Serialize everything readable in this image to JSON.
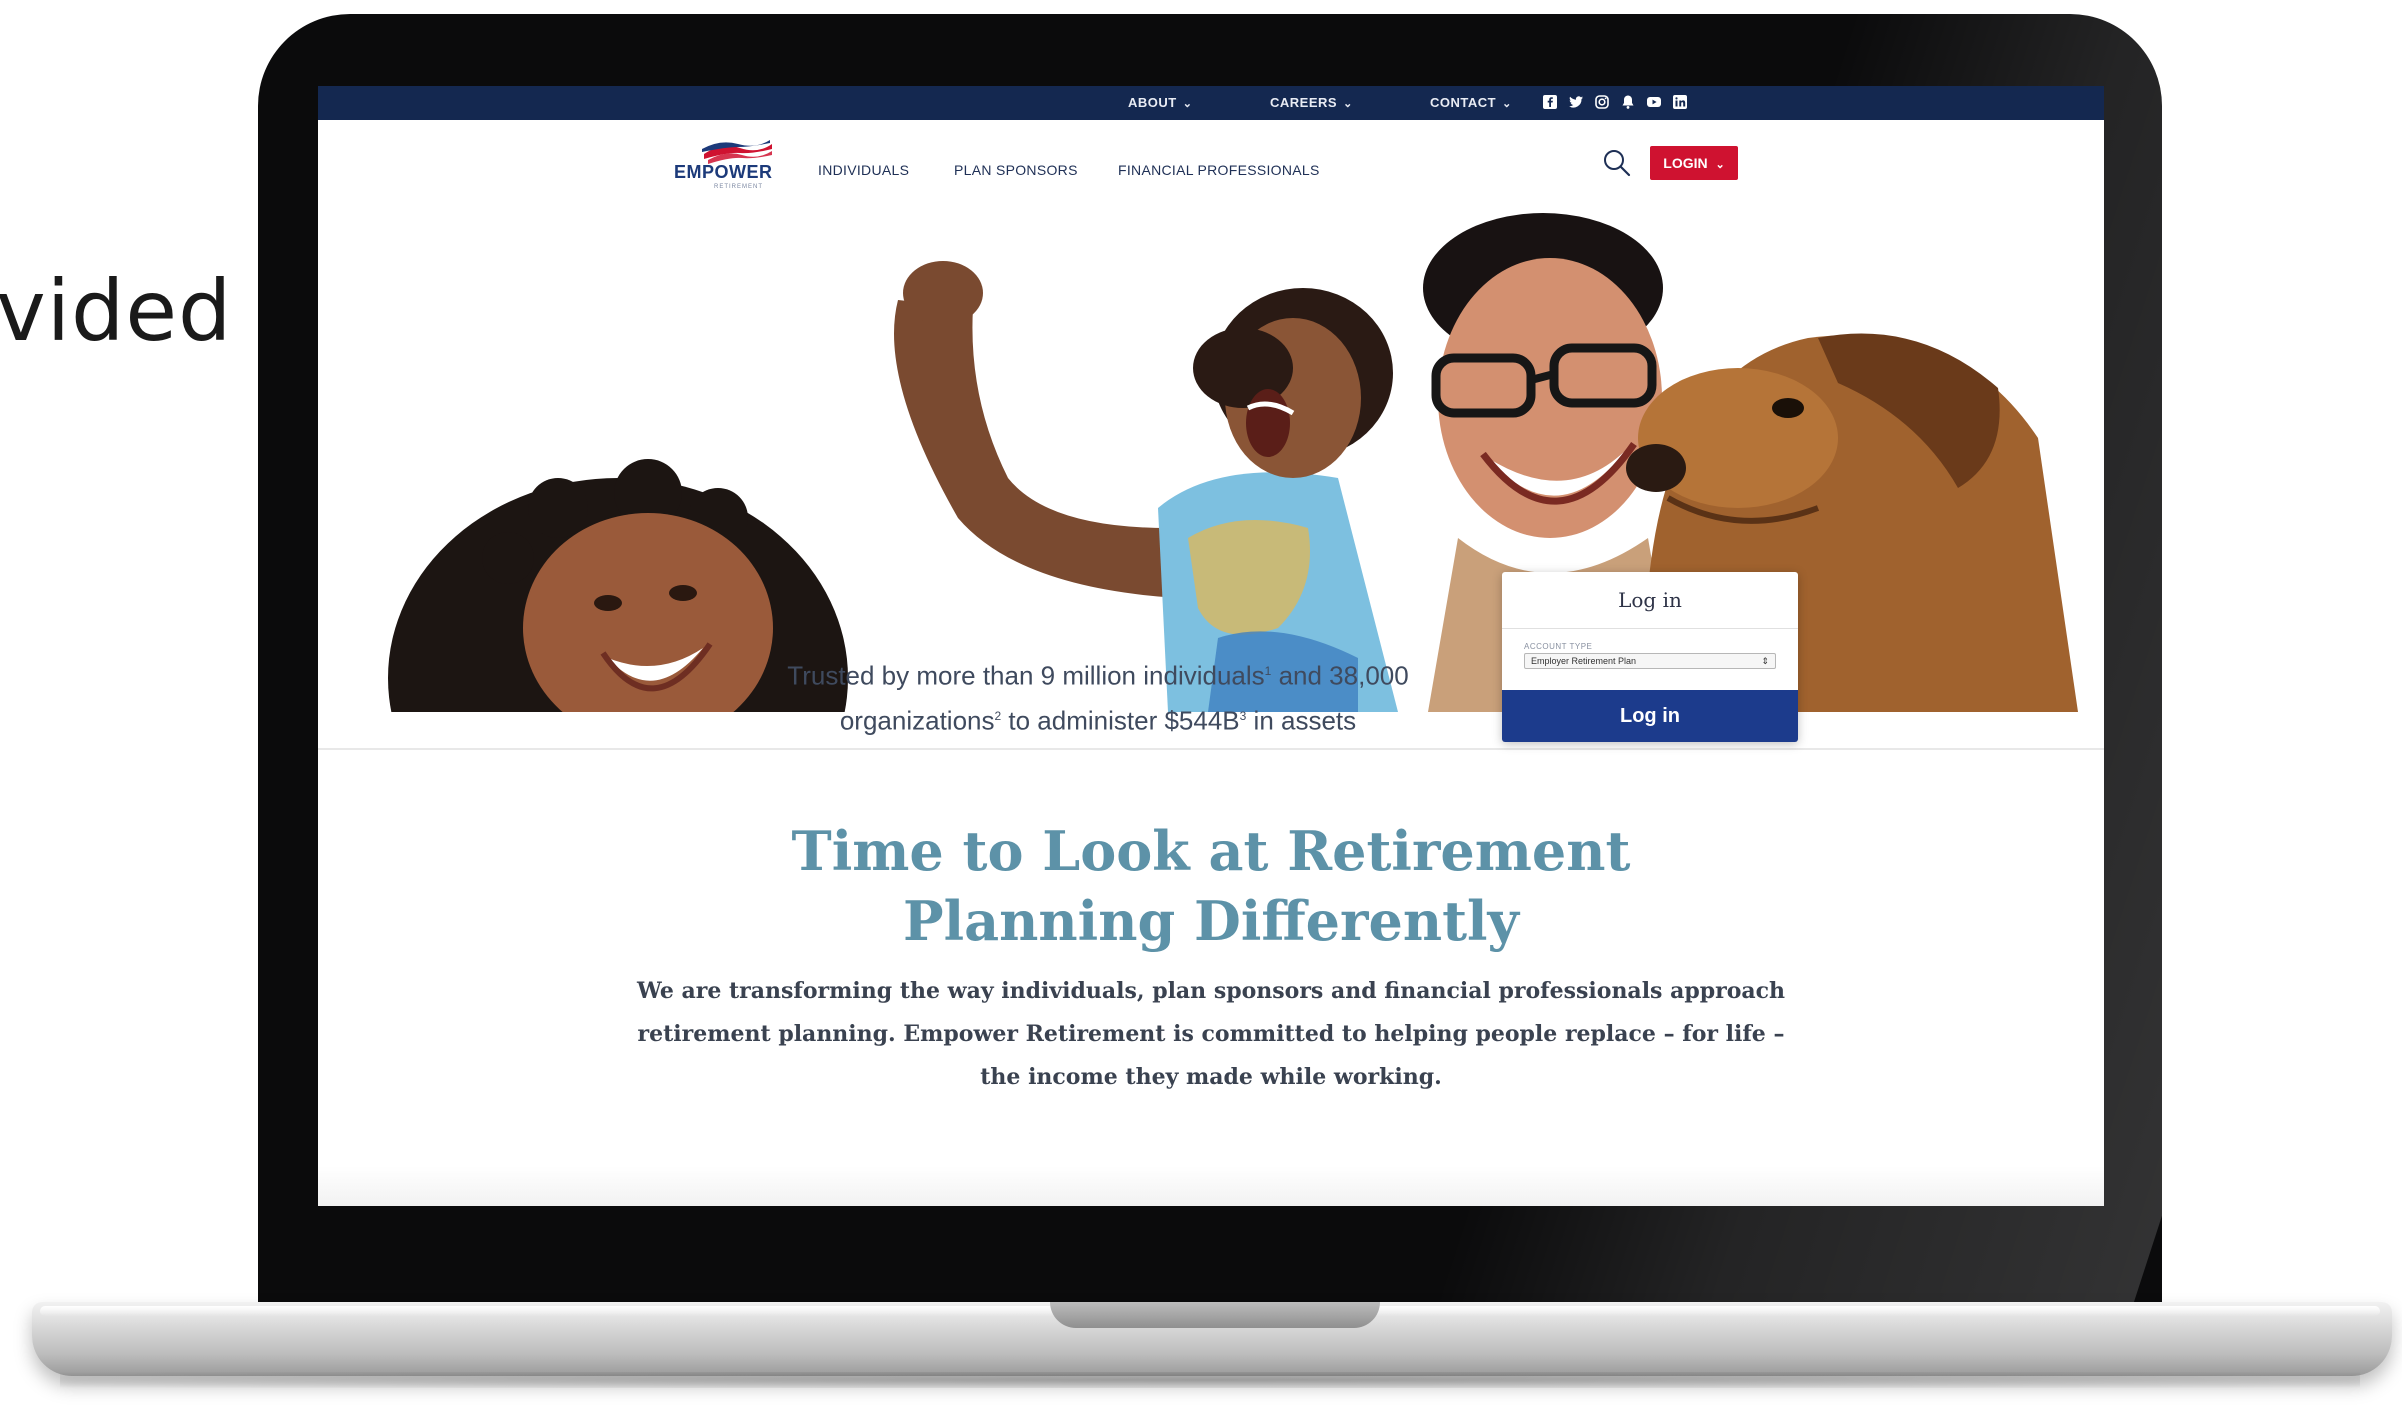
{
  "slide": {
    "text_fragment": "vided"
  },
  "site": {
    "utility_nav": [
      {
        "label": "ABOUT"
      },
      {
        "label": "CAREERS"
      },
      {
        "label": "CONTACT"
      }
    ],
    "social_icons": [
      "facebook-icon",
      "twitter-icon",
      "instagram-icon",
      "notification-icon",
      "youtube-icon",
      "linkedin-icon"
    ],
    "logo": {
      "wordmark": "EMPOWER",
      "tagline": "RETIREMENT"
    },
    "main_nav": [
      {
        "label": "INDIVIDUALS"
      },
      {
        "label": "PLAN SPONSORS"
      },
      {
        "label": "FINANCIAL PROFESSIONALS"
      }
    ],
    "login_button": "LOGIN",
    "trust": {
      "part1": "Trusted by more than 9 million individuals",
      "sup1": "1",
      "part2": " and 38,000 organizations",
      "sup2": "2",
      "part3": " to administer $544B",
      "sup3": "3",
      "part4": " in assets"
    },
    "login_card": {
      "title": "Log in",
      "account_type_label": "ACCOUNT TYPE",
      "account_type_value": "Employer Retirement Plan",
      "submit": "Log in"
    },
    "headline": "Time to Look at Retirement Planning Differently",
    "body": "We are transforming the way individuals, plan sponsors and financial professionals approach retirement planning. Empower Retirement is committed to helping people replace – for life – the income they made while working."
  },
  "colors": {
    "utility_bar": "#142850",
    "login_button": "#cf1230",
    "card_button": "#1c3b8c",
    "headline": "#5d92a8"
  }
}
